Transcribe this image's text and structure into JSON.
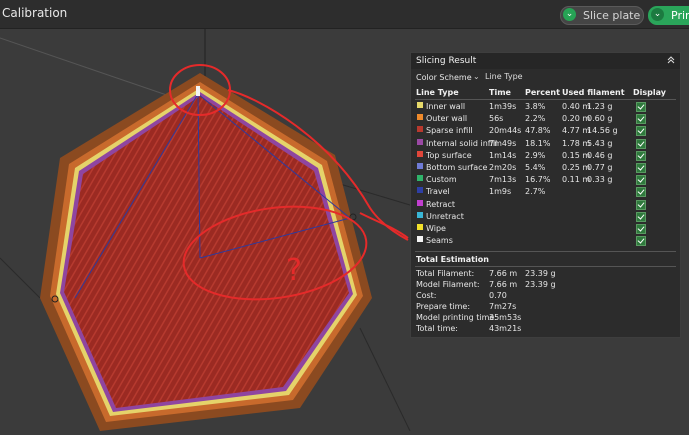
{
  "app": {
    "title": "Calibration"
  },
  "toolbar": {
    "slice_label": "Slice plate",
    "print_label": "Print"
  },
  "panel": {
    "title": "Slicing Result",
    "color_scheme_label": "Color Scheme",
    "color_scheme_value": "Line Type",
    "columns": [
      "Line Type",
      "Time",
      "Percent",
      "Used filament",
      "Display"
    ],
    "rows": [
      {
        "name": "Inner wall",
        "time": "1m39s",
        "percent": "3.8%",
        "len": "0.40 m",
        "weight": "1.23 g",
        "color": "#e6d96a"
      },
      {
        "name": "Outer wall",
        "time": "56s",
        "percent": "2.2%",
        "len": "0.20 m",
        "weight": "0.60 g",
        "color": "#ef8a2b"
      },
      {
        "name": "Sparse infill",
        "time": "20m44s",
        "percent": "47.8%",
        "len": "4.77 m",
        "weight": "14.56 g",
        "color": "#b8392e"
      },
      {
        "name": "Internal solid infill",
        "time": "7m49s",
        "percent": "18.1%",
        "len": "1.78 m",
        "weight": "5.43 g",
        "color": "#9b49a4"
      },
      {
        "name": "Top surface",
        "time": "1m14s",
        "percent": "2.9%",
        "len": "0.15 m",
        "weight": "0.46 g",
        "color": "#e0463a"
      },
      {
        "name": "Bottom surface",
        "time": "2m20s",
        "percent": "5.4%",
        "len": "0.25 m",
        "weight": "0.77 g",
        "color": "#6f7bd6"
      },
      {
        "name": "Custom",
        "time": "7m13s",
        "percent": "16.7%",
        "len": "0.11 m",
        "weight": "0.33 g",
        "color": "#2fb36a"
      },
      {
        "name": "Travel",
        "time": "1m9s",
        "percent": "2.7%",
        "len": "",
        "weight": "",
        "color": "#2e3fa5"
      },
      {
        "name": "Retract",
        "time": "",
        "percent": "",
        "len": "",
        "weight": "",
        "color": "#c13fcf"
      },
      {
        "name": "Unretract",
        "time": "",
        "percent": "",
        "len": "",
        "weight": "",
        "color": "#39b6d6"
      },
      {
        "name": "Wipe",
        "time": "",
        "percent": "",
        "len": "",
        "weight": "",
        "color": "#f2e12b"
      },
      {
        "name": "Seams",
        "time": "",
        "percent": "",
        "len": "",
        "weight": "",
        "color": "#f3f3f3"
      }
    ],
    "estimation_title": "Total Estimation",
    "estimation": [
      {
        "label": "Total Filament:",
        "v1": "7.66 m",
        "v2": "23.39 g"
      },
      {
        "label": "Model Filament:",
        "v1": "7.66 m",
        "v2": "23.39 g"
      },
      {
        "label": "Cost:",
        "v1": "0.70",
        "v2": ""
      },
      {
        "label": "Prepare time:",
        "v1": "7m27s",
        "v2": ""
      },
      {
        "label": "Model printing time:",
        "v1": "35m53s",
        "v2": ""
      },
      {
        "label": "Total time:",
        "v1": "43m21s",
        "v2": ""
      }
    ]
  },
  "annotation": {
    "mark": "?"
  }
}
